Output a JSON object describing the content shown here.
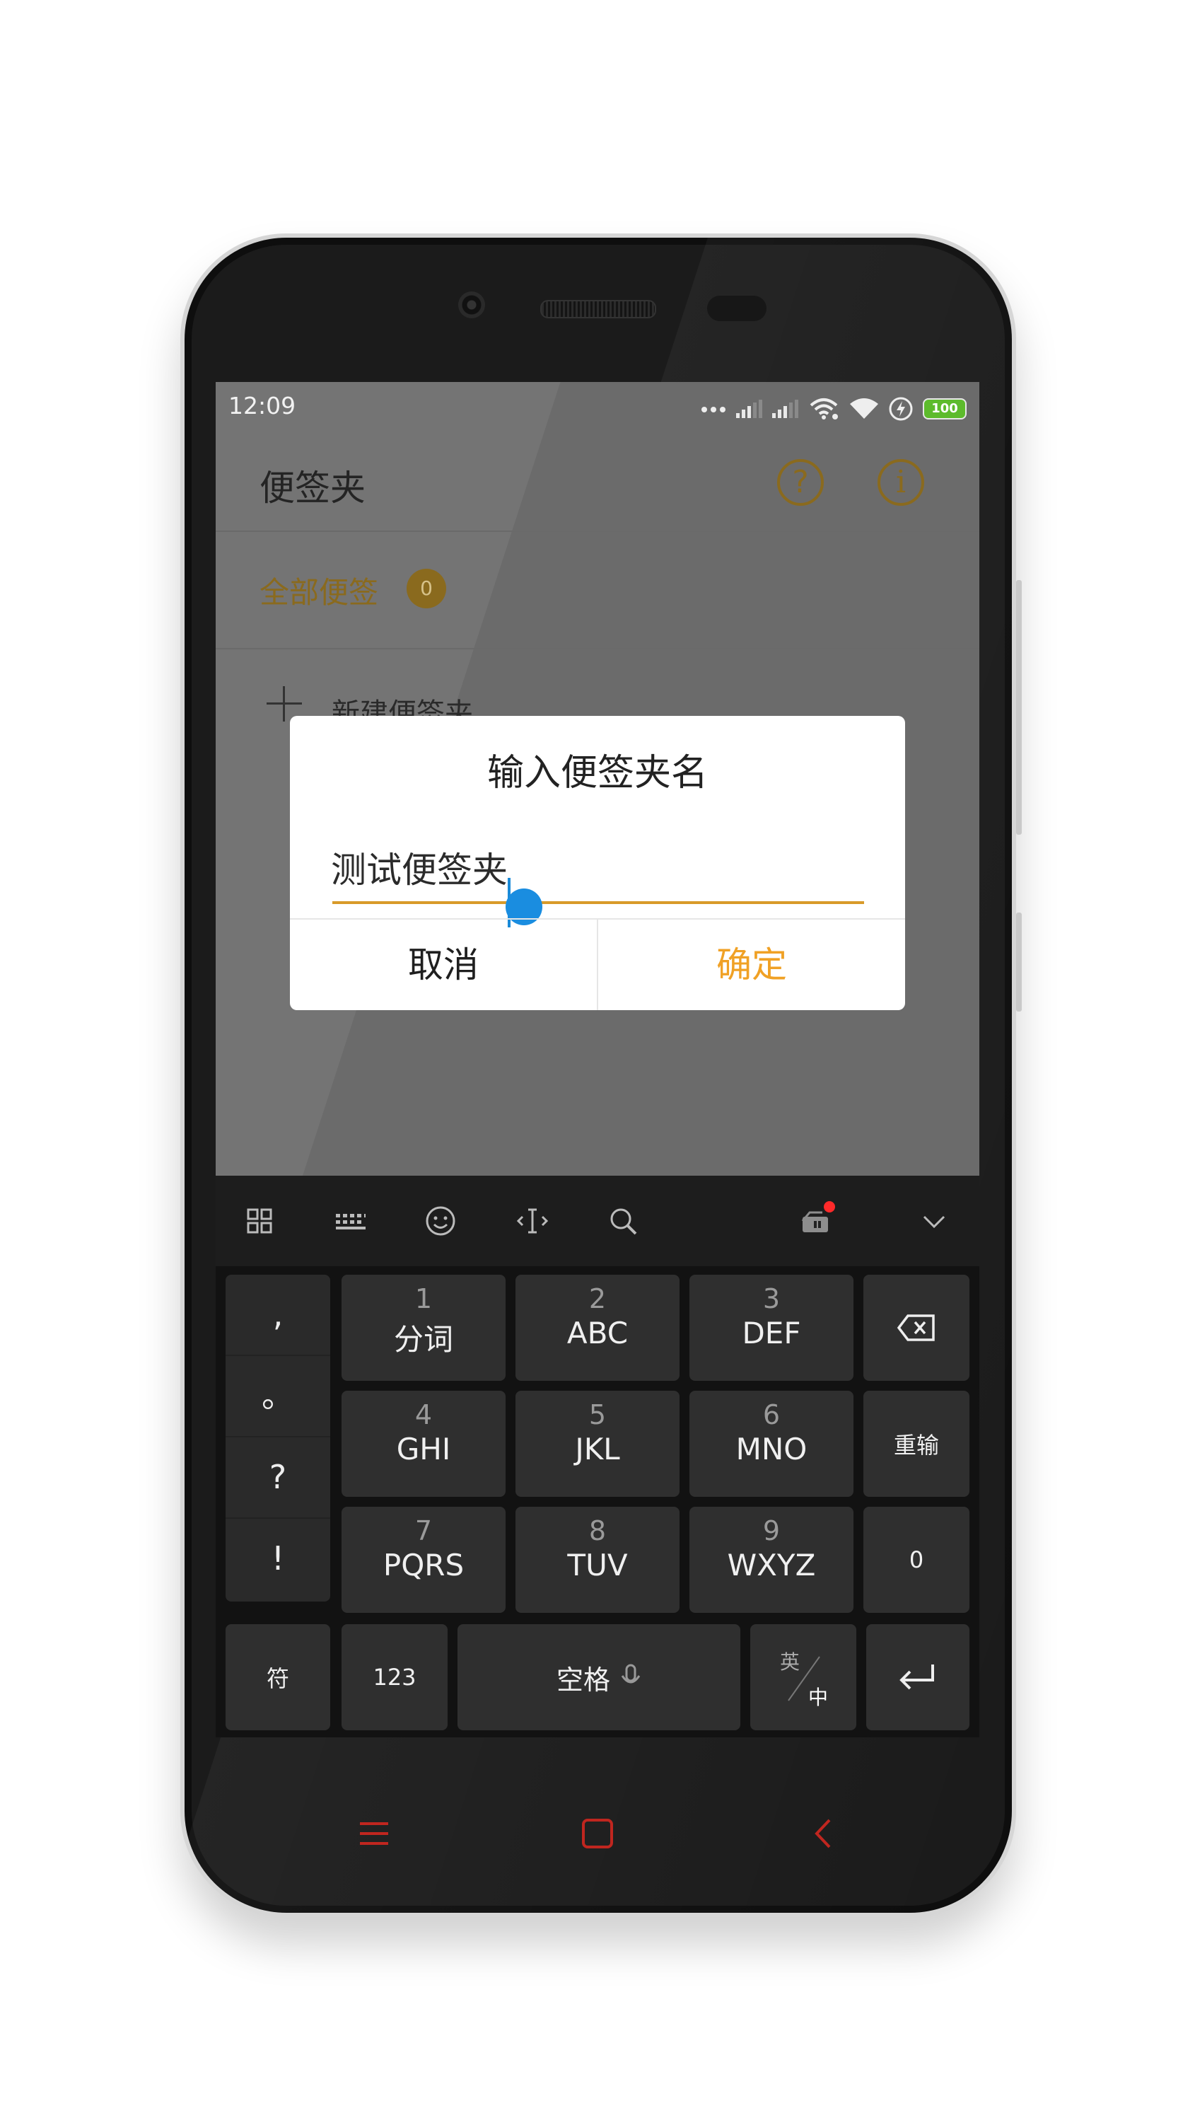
{
  "status_bar": {
    "time": "12:09",
    "battery": "100",
    "icons": [
      "dots-icon",
      "signal-icon",
      "signal-icon",
      "wifi-hotspot-icon",
      "wifi-icon",
      "charging-icon",
      "battery-icon"
    ]
  },
  "app": {
    "title": "便签夹",
    "help_icon": "?",
    "info_icon": "i",
    "all_notes_label": "全部便签",
    "all_notes_count": "0",
    "new_folder_label": "新建便签夹"
  },
  "dialog": {
    "title": "输入便签夹名",
    "input_value": "测试便签夹",
    "cancel_label": "取消",
    "ok_label": "确定"
  },
  "keyboard": {
    "toolbar_icons": [
      "grid-icon",
      "keyboard-icon",
      "emoji-icon",
      "cursor-icon",
      "search-icon",
      "skin-icon",
      "collapse-icon"
    ],
    "punct": [
      ",",
      "。",
      "?",
      "!"
    ],
    "keys": [
      {
        "num": "1",
        "letters": "分词"
      },
      {
        "num": "2",
        "letters": "ABC"
      },
      {
        "num": "3",
        "letters": "DEF"
      },
      {
        "num": "4",
        "letters": "GHI"
      },
      {
        "num": "5",
        "letters": "JKL"
      },
      {
        "num": "6",
        "letters": "MNO"
      },
      {
        "num": "7",
        "letters": "PQRS"
      },
      {
        "num": "8",
        "letters": "TUV"
      },
      {
        "num": "9",
        "letters": "WXYZ"
      }
    ],
    "reinput": "重输",
    "zero": "0",
    "symbol": "符",
    "numbers": "123",
    "space": "空格",
    "lang_en": "英",
    "lang_zh": "中"
  },
  "colors": {
    "accent": "#f0a125",
    "accent_dim": "#8a6a1e",
    "caret": "#1a8de0",
    "nav_red": "#c0261f"
  }
}
